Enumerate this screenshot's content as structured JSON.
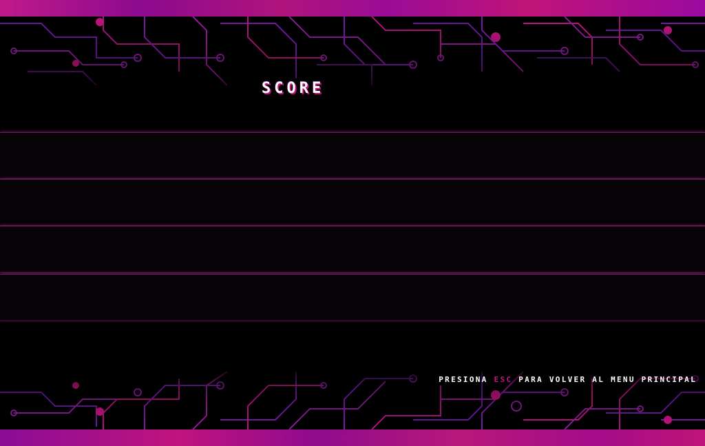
{
  "screen": {
    "title": "SCORE"
  },
  "scoreboard": {
    "rows": [
      {
        "label": ""
      },
      {
        "label": ""
      },
      {
        "label": ""
      },
      {
        "label": ""
      }
    ]
  },
  "footer": {
    "prefix": "PRESIONA ",
    "key": "ESC",
    "suffix": " PARA VOLVER AL MENU PRINCIPAL"
  },
  "colors": {
    "background": "#000000",
    "accent": "#c2167e",
    "circuit_purple": "#7a1aa8",
    "circuit_magenta": "#c0147e",
    "title_text": "#ffffff"
  },
  "icons": {
    "background": "circuit-board-pattern"
  }
}
